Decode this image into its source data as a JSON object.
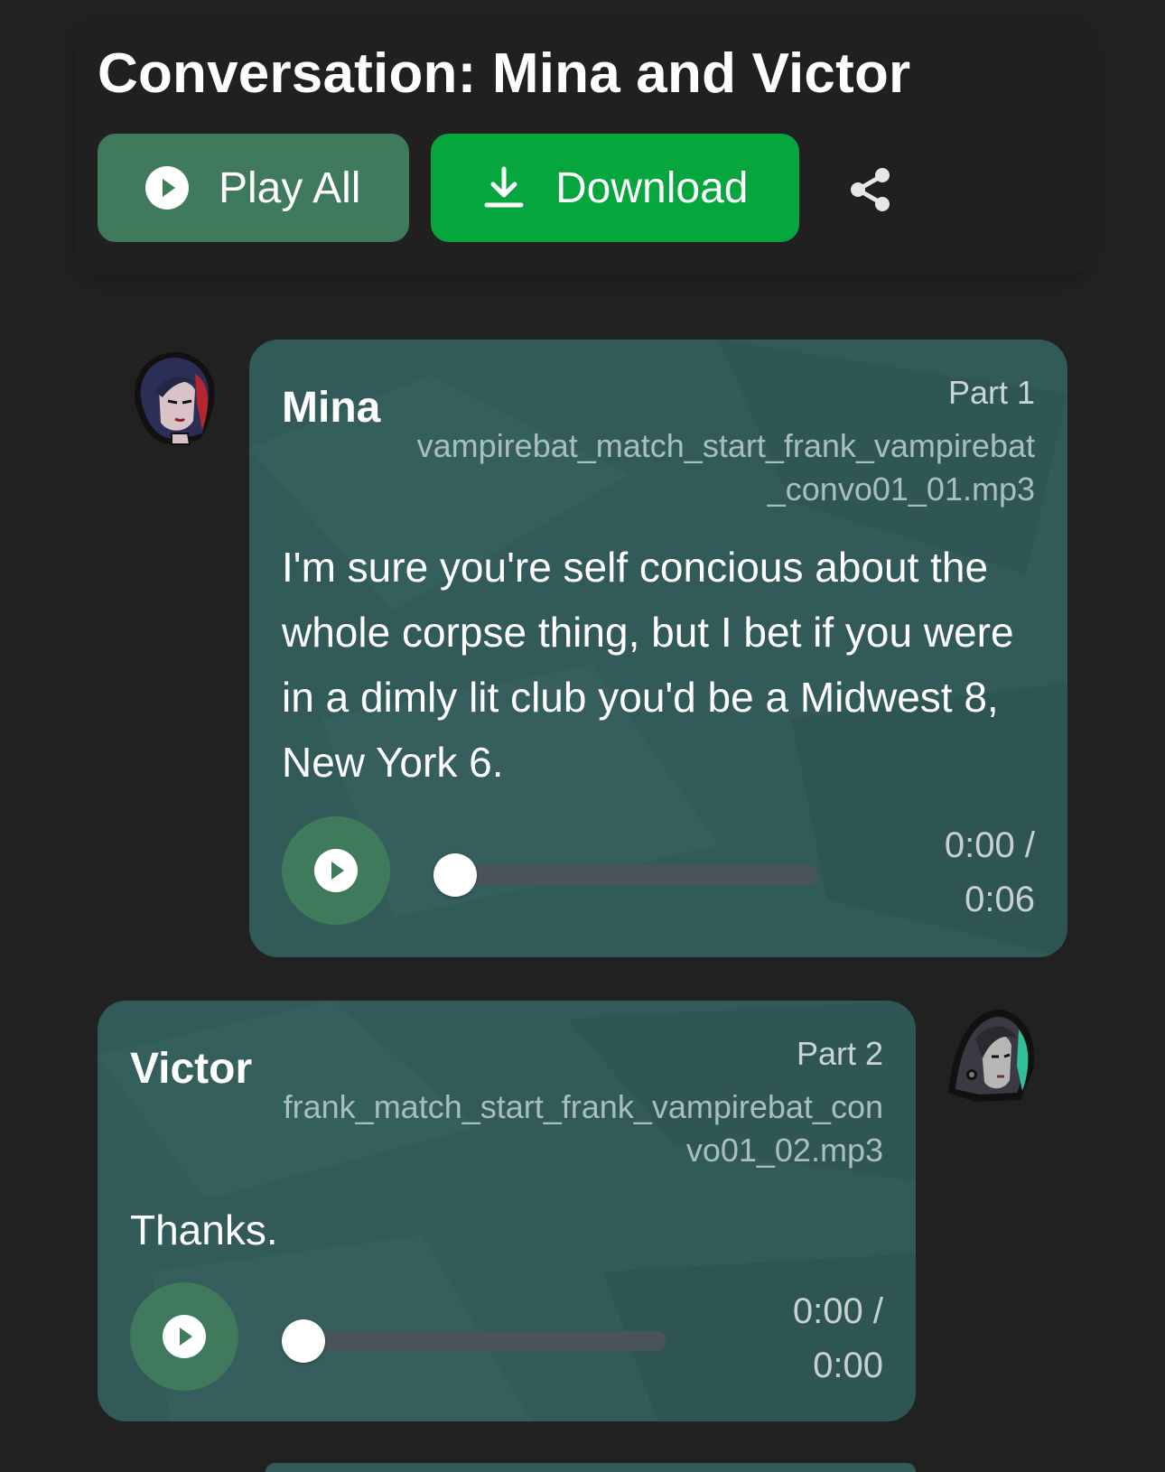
{
  "header": {
    "title": "Conversation: Mina and Victor",
    "play_all_label": "Play All",
    "download_label": "Download"
  },
  "icons": {
    "play": "play-circle-icon",
    "download": "download-icon",
    "share": "share-icon"
  },
  "colors": {
    "background": "#212121",
    "play_all_button": "#3f7a5d",
    "download_button": "#05a63e",
    "message_card": "#325a58"
  },
  "messages": [
    {
      "speaker": "Mina",
      "part": "Part 1",
      "file_line1": "vampirebat_match_start_frank_vampirebat",
      "file_line2": "_convo01_01.mp3",
      "text": "I'm sure you're self concious about the whole corpse thing, but I bet if you were in a dimly lit club you'd be a Midwest 8, New York 6.",
      "time_current": "0:00 /",
      "time_total": "0:06",
      "progress": 0
    },
    {
      "speaker": "Victor",
      "part": "Part 2",
      "file_line1": "frank_match_start_frank_vampirebat_con",
      "file_line2": "vo01_02.mp3",
      "text": "Thanks.",
      "time_current": "0:00 /",
      "time_total": "0:00",
      "progress": 0
    }
  ]
}
